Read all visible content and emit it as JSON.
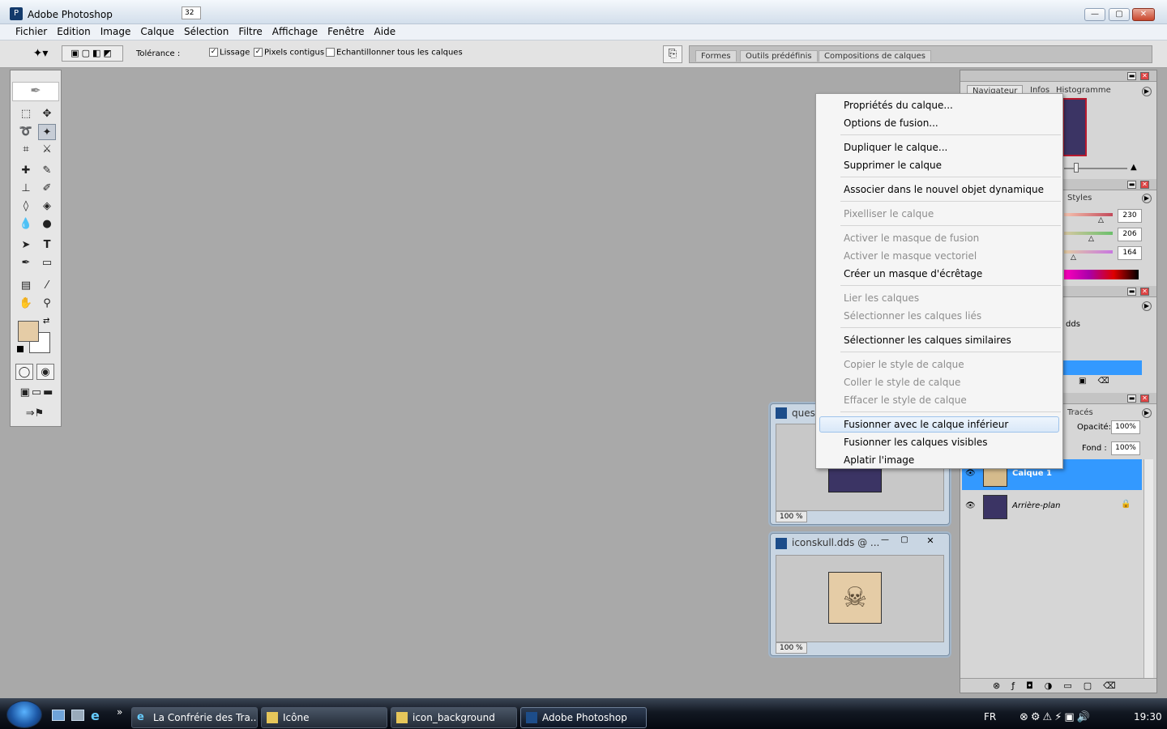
{
  "window": {
    "title": "Adobe Photoshop",
    "minimize": "—",
    "maximize": "▢",
    "close": "✕"
  },
  "menu": [
    "Fichier",
    "Edition",
    "Image",
    "Calque",
    "Sélection",
    "Filtre",
    "Affichage",
    "Fenêtre",
    "Aide"
  ],
  "options": {
    "tolerance_label": "Tolérance :",
    "tolerance_value": "32",
    "lissage": "Lissage",
    "contigus": "Pixels contigus",
    "echantillonner": "Echantillonner tous les calques",
    "lissage_checked": true,
    "contigus_checked": true,
    "echantillonner_checked": false
  },
  "well_tabs": [
    "Formes",
    "Outils prédéfinis",
    "Compositions de calques"
  ],
  "navigator": {
    "tabs": [
      "Navigateur",
      "Infos",
      "Histogramme"
    ]
  },
  "color_panel": {
    "tab": "Styles",
    "r": "230",
    "g": "206",
    "b": "164"
  },
  "channels_panel": {
    "file_label": "dds"
  },
  "layers_panel": {
    "tab": "Tracés",
    "opacity_label": "Opacité:",
    "opacity_value": "100%",
    "fill_label": "Fond :",
    "fill_value": "100%",
    "layers": [
      {
        "name": "Calque 1",
        "selected": true
      },
      {
        "name": "Arrière-plan",
        "selected": false
      }
    ]
  },
  "doc1": {
    "title": "quest",
    "zoom": "100 %"
  },
  "doc2": {
    "title": "iconskull.dds @ ...",
    "zoom": "100 %"
  },
  "context_menu": {
    "items": [
      {
        "label": "Propriétés du calque...",
        "enabled": true
      },
      {
        "label": "Options de fusion...",
        "enabled": true
      },
      {
        "label": "Dupliquer le calque...",
        "enabled": true
      },
      {
        "label": "Supprimer le calque",
        "enabled": true
      },
      {
        "label": "Associer dans le nouvel objet dynamique",
        "enabled": true
      },
      {
        "label": "Pixelliser le calque",
        "enabled": false
      },
      {
        "label": "Activer le masque de fusion",
        "enabled": false
      },
      {
        "label": "Activer le masque vectoriel",
        "enabled": false
      },
      {
        "label": "Créer un masque d'écrêtage",
        "enabled": true
      },
      {
        "label": "Lier les calques",
        "enabled": false
      },
      {
        "label": "Sélectionner les calques liés",
        "enabled": false
      },
      {
        "label": "Sélectionner les calques similaires",
        "enabled": true
      },
      {
        "label": "Copier le style de calque",
        "enabled": false
      },
      {
        "label": "Coller le style de calque",
        "enabled": false
      },
      {
        "label": "Effacer le style de calque",
        "enabled": false
      },
      {
        "label": "Fusionner avec le calque inférieur",
        "enabled": true,
        "highlighted": true
      },
      {
        "label": "Fusionner les calques visibles",
        "enabled": true
      },
      {
        "label": "Aplatir l'image",
        "enabled": true
      }
    ]
  },
  "taskbar": {
    "items": [
      "La Confrérie des Tra...",
      "Icône",
      "icon_background",
      "Adobe Photoshop"
    ],
    "lang": "FR",
    "clock": "19:30",
    "quicklaunch_more": "»"
  },
  "colors": {
    "foreground": "#e5cca6",
    "selection_blue": "#3399ff",
    "background_layer": "#3b3464"
  }
}
